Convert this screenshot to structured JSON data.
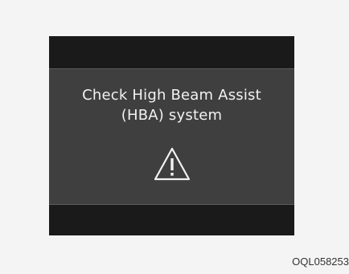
{
  "display": {
    "message_line1": "Check High Beam Assist",
    "message_line2": "(HBA) system",
    "icon": "warning-triangle-icon",
    "colors": {
      "band": "#1a1a1a",
      "panel": "#3f3f3f",
      "text": "#f2f2f2"
    }
  },
  "caption": {
    "code": "OQL058253"
  }
}
